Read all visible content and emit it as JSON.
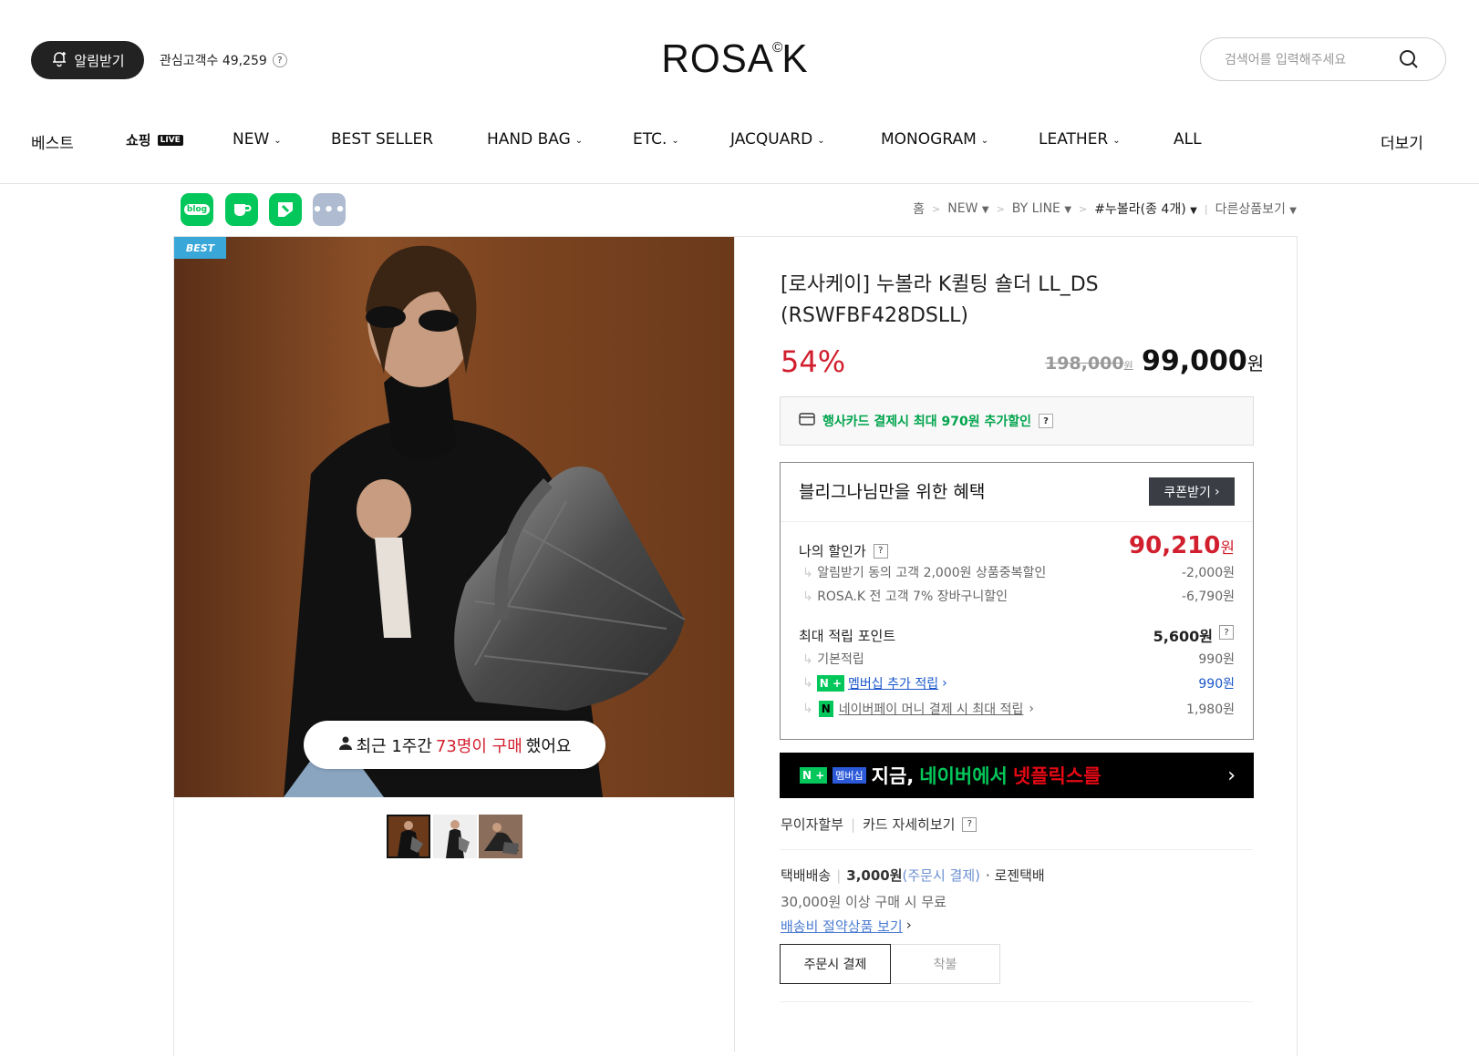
{
  "header": {
    "alarm_label": "알림받기",
    "watch_label": "관심고객수 49,259",
    "logo": "ROSA",
    "logo_mark": "©",
    "logo_end": "K",
    "search_placeholder": "검색어를 입력해주세요"
  },
  "nav": {
    "items": [
      "베스트",
      "쇼핑",
      "NEW",
      "BEST SELLER",
      "HAND BAG",
      "ETC.",
      "JACQUARD",
      "MONOGRAM",
      "LEATHER",
      "ALL"
    ],
    "live_badge": "LIVE",
    "more": "더보기"
  },
  "social": {
    "blog": "blog"
  },
  "breadcrumb": {
    "home": "홈",
    "c1": "NEW",
    "c2": "BY LINE",
    "c3": "#누볼라(종 4개)",
    "other": "다른상품보기"
  },
  "product": {
    "badge": "BEST",
    "purchase_prefix": "최근 1주간",
    "purchase_count": "73명이 구매",
    "purchase_suffix": "했어요",
    "title": "[로사케이] 누볼라 K퀼팅 숄더 LL_DS (RSWFBF428DSLL)",
    "discount": "54%",
    "original_price": "198,000",
    "original_unit": "원",
    "sale_price": "99,000",
    "sale_unit": "원",
    "card_benefit": "행사카드 결제시 최대 970원 추가할인"
  },
  "benefit": {
    "title": "블리그나님만을 위한 혜택",
    "coupon_label": "쿠폰받기",
    "my_price_label": "나의 할인가",
    "my_price": "90,210",
    "my_price_unit": "원",
    "d1_label": "알림받기 동의 고객 2,000원 상품중복할인",
    "d1_value": "-2,000원",
    "d2_label": "ROSA.K 전 고객 7% 장바구니할인",
    "d2_value": "-6,790원",
    "points_label": "최대 적립 포인트",
    "points_value": "5,600원",
    "p1_label": "기본적립",
    "p1_value": "990원",
    "p2_label": "멤버십 추가 적립",
    "p2_value": "990원",
    "p3_label": "네이버페이 머니 결제 시 최대 적립",
    "p3_value": "1,980원"
  },
  "netflix": {
    "membership": "멤버십",
    "text1": "지금,",
    "text2": "네이버에서",
    "text3": "넷플릭스를"
  },
  "misc": {
    "installment": "무이자할부",
    "card_detail": "카드 자세히보기"
  },
  "shipping": {
    "method": "택배배송",
    "fee": "3,000원",
    "fee_note": "(주문시 결제)",
    "carrier": "· 로젠택배",
    "free_note": "30,000원 이상 구매 시 무료",
    "save_link": "배송비 절약상품 보기",
    "tab_pay": "주문시 결제",
    "tab_cod": "착불"
  },
  "colors": {
    "accent_red": "#d11f2e",
    "naver_green": "#03c75a",
    "best_blue": "#3aa7d9"
  }
}
